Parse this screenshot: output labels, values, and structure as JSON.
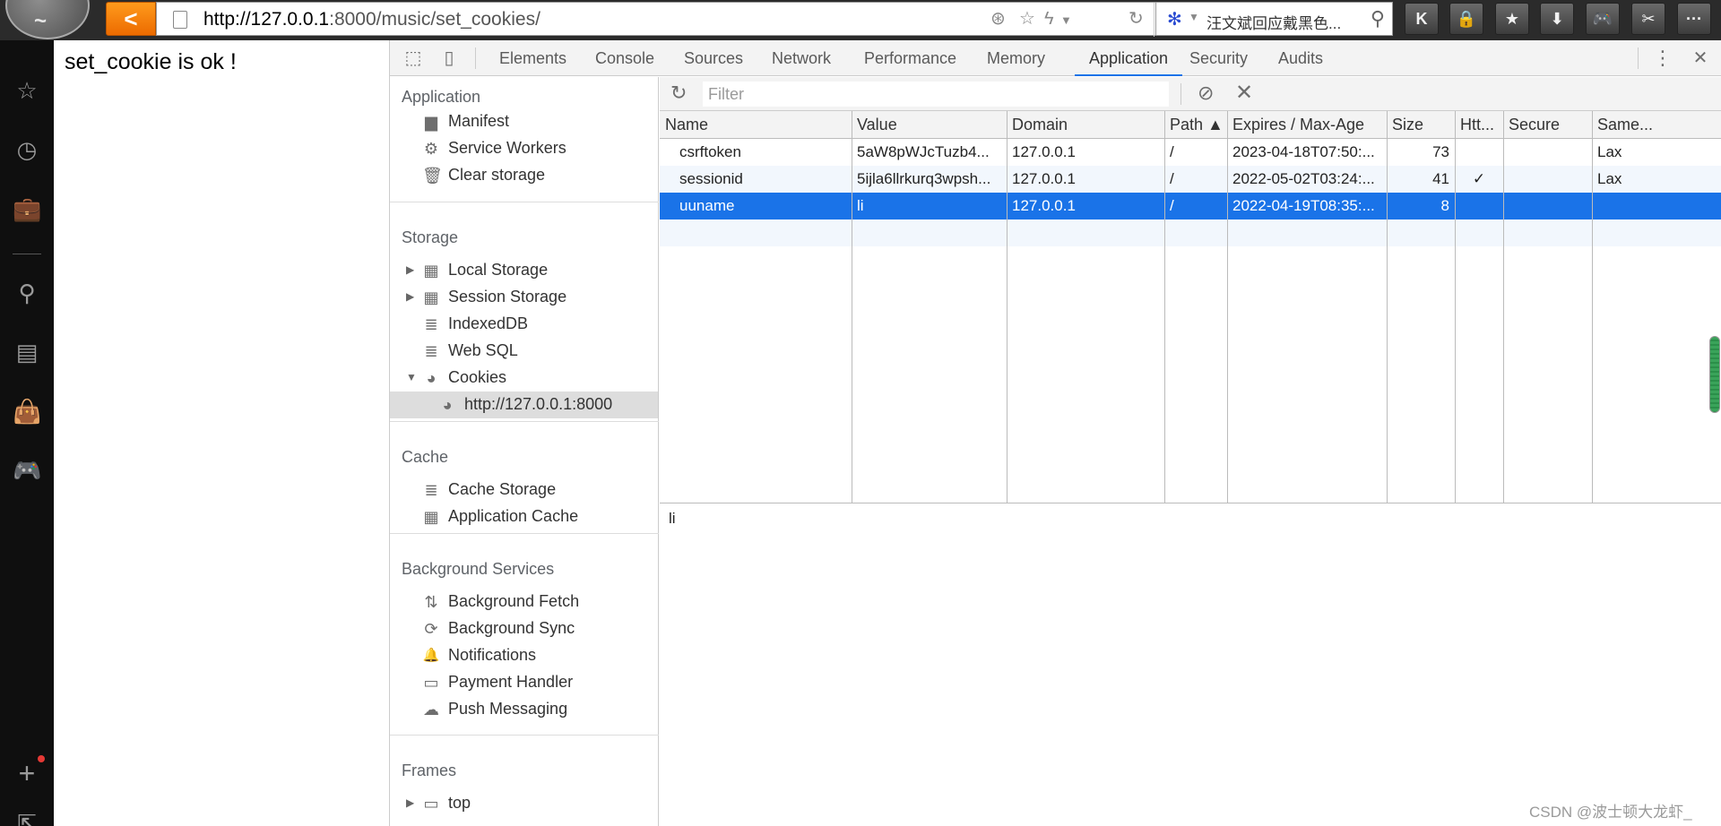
{
  "browser": {
    "url_host": "http://127.0.0.1",
    "url_rest": ":8000/music/set_cookies/",
    "search_text": "汪文斌回应戴黑色...",
    "back_label": "<",
    "logo_glyph": "~",
    "extensions": [
      {
        "icon": "k-icon",
        "glyph": "K"
      },
      {
        "icon": "lock-icon",
        "glyph": "🔒"
      },
      {
        "icon": "star-icon",
        "glyph": "★"
      },
      {
        "icon": "download-icon",
        "glyph": "⬇"
      },
      {
        "icon": "gamepad-icon",
        "glyph": "🎮"
      },
      {
        "icon": "scissors-icon",
        "glyph": "✂"
      },
      {
        "icon": "more-icon",
        "glyph": "···"
      }
    ]
  },
  "sidebar": {
    "icons": [
      "star-icon",
      "history-icon",
      "briefcase-icon",
      "search-icon",
      "news-icon",
      "bag-icon",
      "gamepad-icon",
      "add-icon",
      "collapse-icon"
    ],
    "glyphs": [
      "☆",
      "◷",
      "💼",
      "⚲",
      "▤",
      "👜",
      "🎮",
      "+",
      "⇱"
    ]
  },
  "page": {
    "text": "set_cookie is ok !"
  },
  "devtools": {
    "tabs": [
      "Elements",
      "Console",
      "Sources",
      "Network",
      "Performance",
      "Memory",
      "Application",
      "Security",
      "Audits"
    ],
    "active_tab": "Application",
    "more_glyph": "⋮",
    "close_glyph": "✕",
    "inspect_glyph": "⬚",
    "device_glyph": "▯"
  },
  "app_panel": {
    "application": {
      "header": "Application",
      "items": [
        {
          "label": "Manifest",
          "icon": "file-icon",
          "glyph": "▆"
        },
        {
          "label": "Service Workers",
          "icon": "gear-icon",
          "glyph": "⚙"
        },
        {
          "label": "Clear storage",
          "icon": "trash-icon",
          "glyph": "🗑"
        }
      ]
    },
    "storage": {
      "header": "Storage",
      "items": [
        {
          "label": "Local Storage",
          "icon": "grid-icon",
          "glyph": "▦",
          "triangle": "▶"
        },
        {
          "label": "Session Storage",
          "icon": "grid-icon",
          "glyph": "▦",
          "triangle": "▶"
        },
        {
          "label": "IndexedDB",
          "icon": "database-icon",
          "glyph": "≣",
          "triangle": ""
        },
        {
          "label": "Web SQL",
          "icon": "database-icon",
          "glyph": "≣",
          "triangle": ""
        },
        {
          "label": "Cookies",
          "icon": "cookie-icon",
          "glyph": "◕",
          "triangle": "▼"
        },
        {
          "label": "http://127.0.0.1:8000",
          "icon": "cookie-icon",
          "glyph": "◕",
          "triangle": ""
        }
      ]
    },
    "cache": {
      "header": "Cache",
      "items": [
        {
          "label": "Cache Storage",
          "icon": "database-icon",
          "glyph": "≣"
        },
        {
          "label": "Application Cache",
          "icon": "grid-icon",
          "glyph": "▦"
        }
      ]
    },
    "background": {
      "header": "Background Services",
      "items": [
        {
          "label": "Background Fetch",
          "icon": "fetch-arrows-icon",
          "glyph": "⇅"
        },
        {
          "label": "Background Sync",
          "icon": "sync-icon",
          "glyph": "⟳"
        },
        {
          "label": "Notifications",
          "icon": "bell-icon",
          "glyph": "🔔"
        },
        {
          "label": "Payment Handler",
          "icon": "card-icon",
          "glyph": "▭"
        },
        {
          "label": "Push Messaging",
          "icon": "cloud-icon",
          "glyph": "☁"
        }
      ]
    },
    "frames": {
      "header": "Frames",
      "items": [
        {
          "label": "top",
          "icon": "frame-icon",
          "glyph": "▭",
          "triangle": "▶"
        }
      ]
    }
  },
  "cookies": {
    "filter_placeholder": "Filter",
    "refresh_glyph": "↻",
    "clear_glyph": "⊘",
    "delete_glyph": "✕",
    "columns": [
      "Name",
      "Value",
      "Domain",
      "Path ▲",
      "Expires / Max-Age",
      "Size",
      "Htt...",
      "Secure",
      "Same..."
    ],
    "rows": [
      [
        "csrftoken",
        "5aW8pWJcTuzb4...",
        "127.0.0.1",
        "/",
        "2023-04-18T07:50:...",
        "73",
        "",
        "",
        "Lax"
      ],
      [
        "sessionid",
        "5ijla6llrkurq3wpsh...",
        "127.0.0.1",
        "/",
        "2022-05-02T03:24:...",
        "41",
        "✓",
        "",
        "Lax"
      ],
      [
        "uuname",
        "li",
        "127.0.0.1",
        "/",
        "2022-04-19T08:35:...",
        "8",
        "",
        "",
        ""
      ]
    ],
    "selected_row": 2,
    "preview_value": "li"
  },
  "watermark": "CSDN @波士顿大龙虾_"
}
